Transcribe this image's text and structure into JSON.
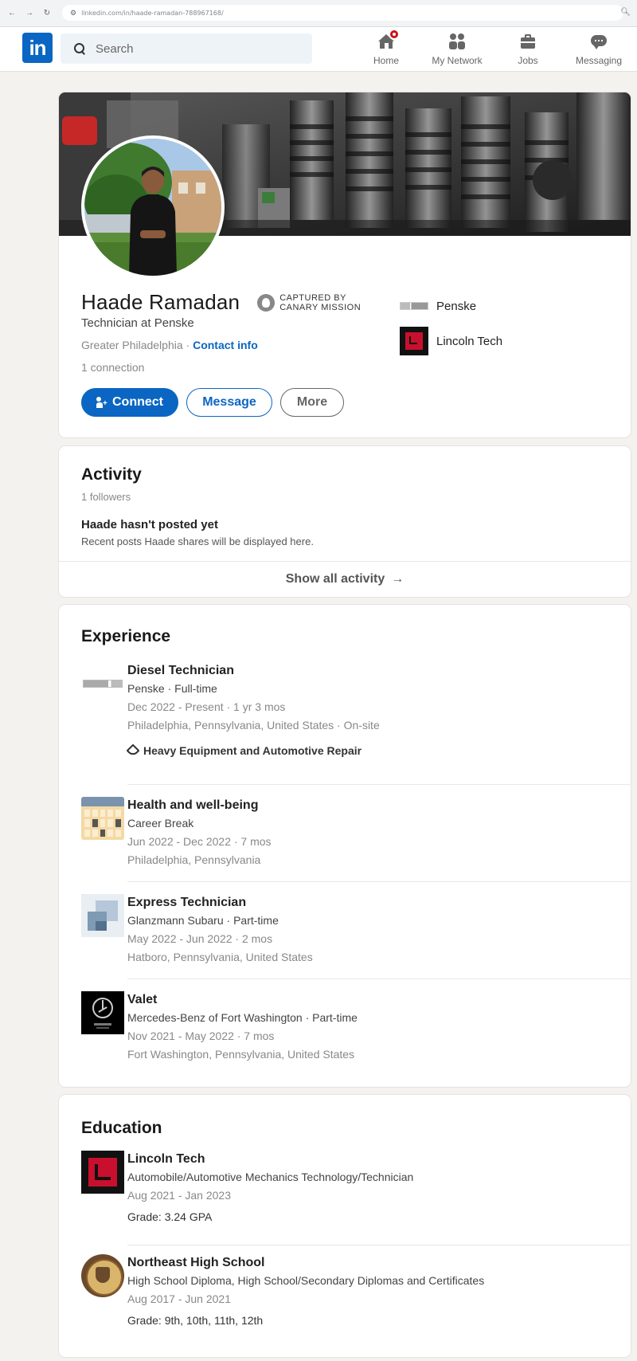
{
  "browser": {
    "url": "linkedin.com/in/haade-ramadan-788967168/"
  },
  "nav": {
    "search_placeholder": "Search",
    "items": [
      {
        "label": "Home",
        "icon": "home-icon"
      },
      {
        "label": "My Network",
        "icon": "network-icon"
      },
      {
        "label": "Jobs",
        "icon": "jobs-icon"
      },
      {
        "label": "Messaging",
        "icon": "messaging-icon"
      }
    ],
    "logo_text": "in"
  },
  "profile": {
    "name": "Haade Ramadan",
    "badge_line1": "CAPTURED BY",
    "badge_line2": "CANARY MISSION",
    "headline": "Technician at Penske",
    "location": "Greater Philadelphia",
    "location_sep": " · ",
    "contact_info": "Contact info",
    "connections": "1 connection",
    "buttons": {
      "connect": "Connect",
      "message": "Message",
      "more": "More"
    },
    "companies": [
      {
        "name": "Penske"
      },
      {
        "name": "Lincoln Tech"
      }
    ]
  },
  "activity": {
    "title": "Activity",
    "followers": "1 followers",
    "empty_title": "Haade hasn't posted yet",
    "empty_sub": "Recent posts Haade shares will be displayed here.",
    "show_all": "Show all activity",
    "arrow": "→"
  },
  "experience": {
    "title": "Experience",
    "items": [
      {
        "title": "Diesel Technician",
        "company": "Penske · Full-time",
        "dates": "Dec 2022 - Present · 1 yr 3 mos",
        "location": "Philadelphia, Pennsylvania, United States · On-site",
        "skill": "Heavy Equipment and Automotive Repair"
      },
      {
        "title": "Health and well-being",
        "company": "Career Break",
        "dates": "Jun 2022 - Dec 2022 · 7 mos",
        "location": "Philadelphia, Pennsylvania"
      },
      {
        "title": "Express Technician",
        "company": "Glanzmann Subaru · Part-time",
        "dates": "May 2022 - Jun 2022 · 2 mos",
        "location": "Hatboro, Pennsylvania, United States"
      },
      {
        "title": "Valet",
        "company": "Mercedes-Benz of Fort Washington · Part-time",
        "dates": "Nov 2021 - May 2022 · 7 mos",
        "location": "Fort Washington, Pennsylvania, United States"
      }
    ]
  },
  "education": {
    "title": "Education",
    "items": [
      {
        "school": "Lincoln Tech",
        "degree": "Automobile/Automotive Mechanics Technology/Technician",
        "dates": "Aug 2021 - Jan 2023",
        "grade": "Grade: 3.24 GPA"
      },
      {
        "school": "Northeast High School",
        "degree": "High School Diploma, High School/Secondary Diplomas and Certificates",
        "dates": "Aug 2017 - Jun 2021",
        "grade": "Grade: 9th, 10th, 11th, 12th"
      }
    ]
  },
  "colors": {
    "brand": "#0a66c2",
    "notification": "#cc1016",
    "page_bg": "#f3f2ef"
  }
}
